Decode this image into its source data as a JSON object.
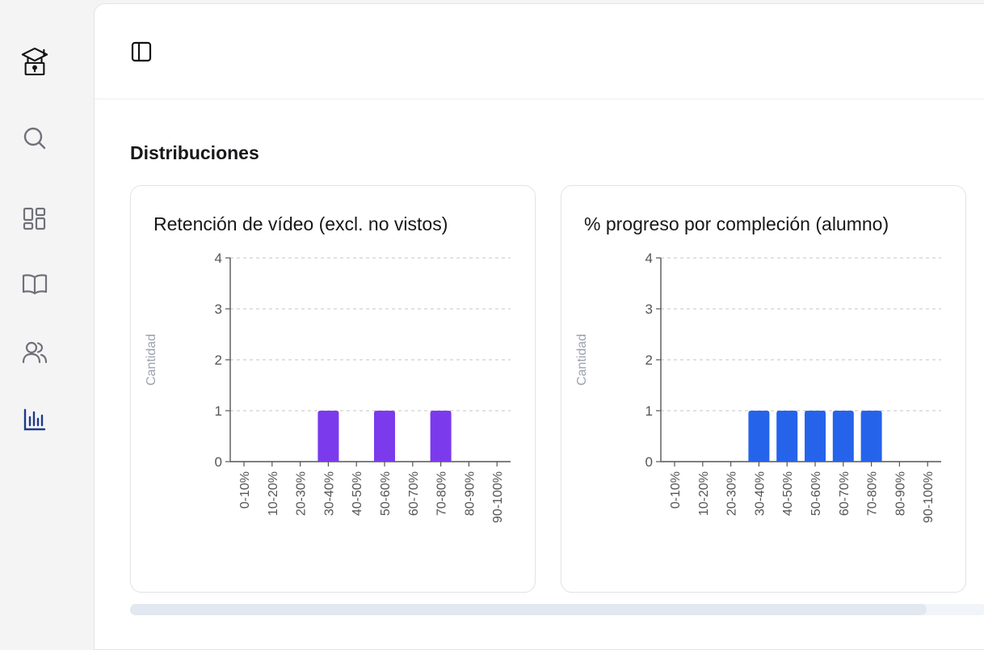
{
  "sidebar": {
    "items": [
      {
        "icon": "academy-lock-icon",
        "active": true
      },
      {
        "icon": "search-icon",
        "active": false
      },
      {
        "icon": "dashboard-icon",
        "active": false
      },
      {
        "icon": "book-icon",
        "active": false
      },
      {
        "icon": "users-icon",
        "active": false
      },
      {
        "icon": "bar-chart-icon",
        "active": true
      }
    ]
  },
  "topbar": {
    "toggle_icon": "sidebar-toggle-icon"
  },
  "main": {
    "section_title": "Distribuciones"
  },
  "colors": {
    "purple_bar": "#7c3aed",
    "blue_bar": "#2563eb",
    "active_nav": "#1e3a8a",
    "inactive_nav": "#71717a"
  },
  "chart_data": [
    {
      "type": "bar",
      "title": "Retención de vídeo (excl. no vistos)",
      "ylabel": "Cantidad",
      "xlabel": "",
      "categories": [
        "0-10%",
        "10-20%",
        "20-30%",
        "30-40%",
        "40-50%",
        "50-60%",
        "60-70%",
        "70-80%",
        "80-90%",
        "90-100%"
      ],
      "values": [
        0,
        0,
        0,
        1,
        0,
        1,
        0,
        1,
        0,
        0
      ],
      "ylim": [
        0,
        4
      ],
      "yticks": [
        "0",
        "1",
        "2",
        "3",
        "4"
      ],
      "grid": "horizontal-dashed",
      "color": "#7c3aed"
    },
    {
      "type": "bar",
      "title": "% progreso por compleción (alumno)",
      "ylabel": "Cantidad",
      "xlabel": "",
      "categories": [
        "0-10%",
        "10-20%",
        "20-30%",
        "30-40%",
        "40-50%",
        "50-60%",
        "60-70%",
        "70-80%",
        "80-90%",
        "90-100%"
      ],
      "values": [
        0,
        0,
        0,
        1,
        1,
        1,
        1,
        1,
        0,
        0
      ],
      "ylim": [
        0,
        4
      ],
      "yticks": [
        "0",
        "1",
        "2",
        "3",
        "4"
      ],
      "grid": "horizontal-dashed",
      "color": "#2563eb"
    }
  ],
  "scrollbar": {
    "position": 0.0,
    "visible_fraction": 0.93
  }
}
